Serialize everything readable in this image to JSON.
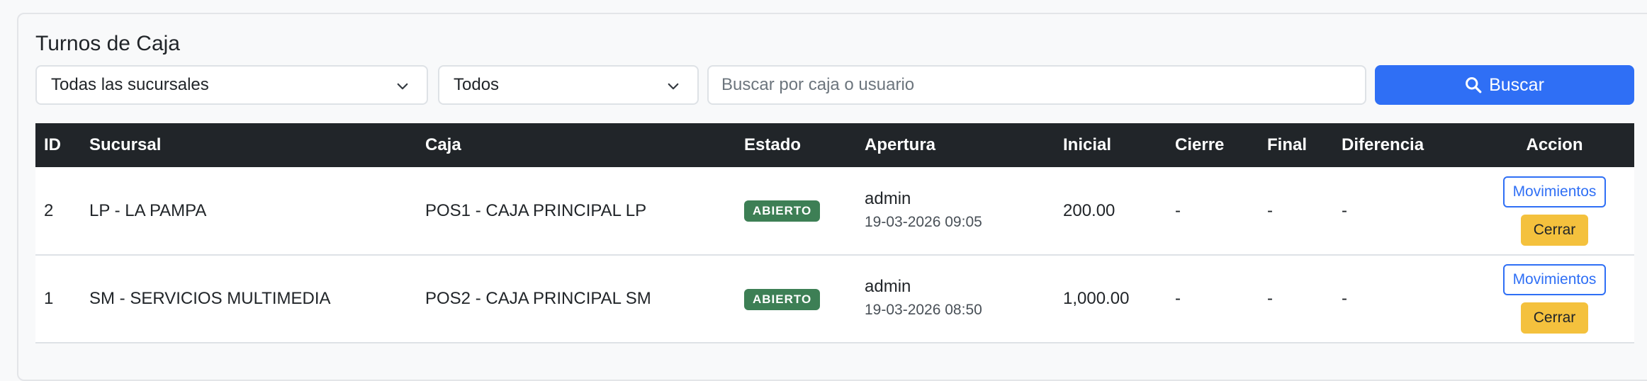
{
  "page": {
    "title": "Turnos de Caja"
  },
  "filters": {
    "branch_select": {
      "value": "Todas las sucursales"
    },
    "status_select": {
      "value": "Todos"
    },
    "search": {
      "placeholder": "Buscar por caja o usuario",
      "value": ""
    },
    "search_button": {
      "label": "Buscar",
      "icon": "search-icon"
    }
  },
  "colors": {
    "primary": "#2f6ff5",
    "header_bg": "#212529",
    "badge_open": "#3d7f55",
    "warning": "#f4c13d"
  },
  "table": {
    "headers": {
      "id": "ID",
      "sucursal": "Sucursal",
      "caja": "Caja",
      "estado": "Estado",
      "apertura": "Apertura",
      "inicial": "Inicial",
      "cierre": "Cierre",
      "final": "Final",
      "diferencia": "Diferencia",
      "accion": "Accion"
    },
    "rows": [
      {
        "id": "2",
        "sucursal": "LP - LA PAMPA",
        "caja": "POS1 - CAJA PRINCIPAL LP",
        "estado": "ABIERTO",
        "apertura_user": "admin",
        "apertura_date": "19-03-2026 09:05",
        "inicial": "200.00",
        "cierre": "-",
        "final": "-",
        "diferencia": "-",
        "btn_movimientos": "Movimientos",
        "btn_cerrar": "Cerrar"
      },
      {
        "id": "1",
        "sucursal": "SM - SERVICIOS MULTIMEDIA",
        "caja": "POS2 - CAJA PRINCIPAL SM",
        "estado": "ABIERTO",
        "apertura_user": "admin",
        "apertura_date": "19-03-2026 08:50",
        "inicial": "1,000.00",
        "cierre": "-",
        "final": "-",
        "diferencia": "-",
        "btn_movimientos": "Movimientos",
        "btn_cerrar": "Cerrar"
      }
    ]
  }
}
